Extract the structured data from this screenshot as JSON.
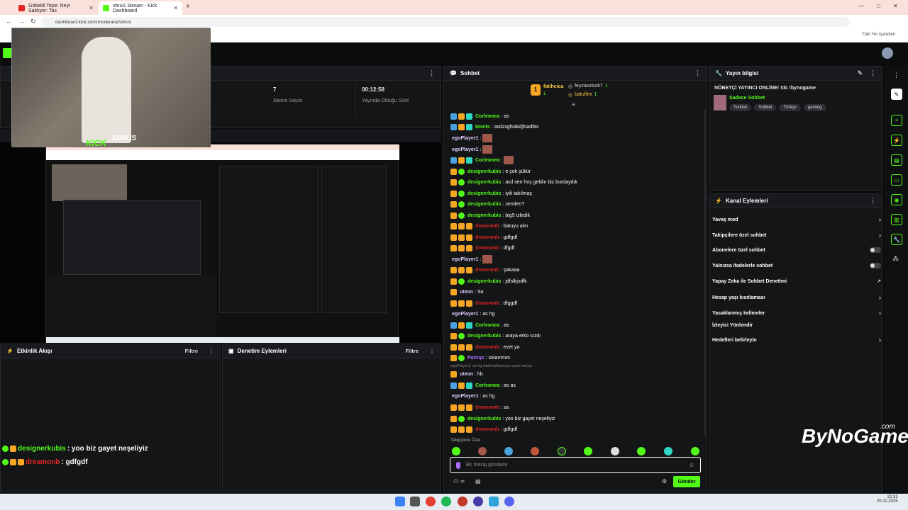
{
  "browser": {
    "tabs": [
      {
        "title": "Göbekli Tepe: Neyi Saklıyor: Tas"
      },
      {
        "title": "xbruS Stream - Kick Dashboard"
      }
    ],
    "new_tab": "+",
    "url": "dashboard.kick.com/moderator/xbrus",
    "bookmarks_label": "Tüm Yer İşaretleri",
    "window_controls": [
      "—",
      "□",
      "✕"
    ]
  },
  "stats": {
    "abone_value": "7",
    "abone_label": "Abone Sayısı",
    "time_value": "00:12:58",
    "time_label": "Yayında Olduğu Süre"
  },
  "webcam": {
    "brand": "KICK",
    "name": "XBRUS"
  },
  "activity": {
    "title": "Etkinlik Akışı",
    "filter": "Filtre"
  },
  "moderation": {
    "title": "Denetim Eylemleri",
    "filter": "Filtre"
  },
  "overlay_chat": [
    {
      "user": "designerkubis",
      "text": ": yoo biz gayet neşeliyiz"
    },
    {
      "user": "dreamonb",
      "text": ": gdfgdf"
    }
  ],
  "chat": {
    "title": "Sohbet",
    "top_gifter": {
      "name": "fatihcica",
      "count": "1"
    },
    "gifters": [
      {
        "name": "feyzaozturk7",
        "count": "1"
      },
      {
        "name": "batuflex",
        "count": "1"
      }
    ],
    "messages": [
      {
        "user": "Corleonea",
        "text": ": as",
        "color": "#53fc18"
      },
      {
        "user": "kmnts",
        "text": ": asdzxgfsakdjfsadfas",
        "color": "#53fc18"
      },
      {
        "user": "egoPlayer1",
        "text": ":",
        "color": "#e0c9ff"
      },
      {
        "user": "egoPlayer1",
        "text": ":",
        "color": "#e0c9ff"
      },
      {
        "user": "Corleonea",
        "text": ":",
        "color": "#53fc18"
      },
      {
        "user": "designerkubis",
        "text": ": e çok şükür",
        "color": "#53fc18"
      },
      {
        "user": "designerkubis",
        "text": ": asıl sen hoş geldin biz burdaydık",
        "color": "#53fc18"
      },
      {
        "user": "designerkubis",
        "text": ": iyili takılmaç",
        "color": "#53fc18"
      },
      {
        "user": "designerkubis",
        "text": ": senden?",
        "color": "#53fc18"
      },
      {
        "user": "designerkubis",
        "text": ": big5 izledik",
        "color": "#53fc18"
      },
      {
        "user": "dreamonb",
        "text": ": batuyu alın",
        "color": "#e02424"
      },
      {
        "user": "dreamonb",
        "text": ": gdfgdf",
        "color": "#e02424"
      },
      {
        "user": "dreamonb",
        "text": ": dfgdf",
        "color": "#e02424"
      },
      {
        "user": "egoPlayer1",
        "text": ":",
        "color": "#e0c9ff"
      },
      {
        "user": "dreamonb",
        "text": ": şakaaa",
        "color": "#e02424"
      },
      {
        "user": "designerkubis",
        "text": ": jdfslkjsdfk",
        "color": "#53fc18"
      },
      {
        "user": "uteon",
        "text": ": Sa",
        "color": "#e0c9ff"
      },
      {
        "user": "dreamonb",
        "text": ": dfggdf",
        "color": "#e02424"
      },
      {
        "user": "egoPlayer1",
        "text": ": as hg",
        "color": "#e0c9ff"
      },
      {
        "user": "Corleonea",
        "text": ": as",
        "color": "#53fc18"
      },
      {
        "user": "designerkubis",
        "text": ": araya erko sızdı",
        "color": "#53fc18"
      },
      {
        "user": "dreamonb",
        "text": ": evet ya",
        "color": "#e02424"
      },
      {
        "user": "Patriqs",
        "text": ": selammm",
        "color": "#a970ff"
      },
      {
        "user": "uteon",
        "text": ": hb",
        "color": "#e0c9ff"
      },
      {
        "user": "Corleonea",
        "text": ": as as",
        "color": "#53fc18"
      },
      {
        "user": "egoPlayer1",
        "text": ": as hg",
        "color": "#e0c9ff"
      },
      {
        "user": "dreamonb",
        "text": ": sa",
        "color": "#e02424"
      },
      {
        "user": "designerkubis",
        "text": ": yoo biz gayet neşeliyiz",
        "color": "#53fc18"
      },
      {
        "user": "dreamonb",
        "text": ": gdfgdf",
        "color": "#e02424"
      }
    ],
    "reply_note": "egoPlayer1: as hg isteli kullanıcıya yanıt veriyor",
    "followers_only": "Takipçilere Özel",
    "input_placeholder": "Bir mesaj gönderin",
    "send": "Gönder",
    "infinity": "∞"
  },
  "stream_info": {
    "title": "Yayın bilgisi",
    "stream_title": "NÖBETÇİ YAYINCI ONLİNE! !dc !bynogame",
    "category": "Sadece Sohbet",
    "tags": [
      "Turkish",
      "Sohbet",
      "Türkçe",
      "gaming"
    ]
  },
  "channel_actions": {
    "title": "Kanal Eylemleri",
    "items": [
      {
        "label": "Yavaş mod",
        "control": "arrow"
      },
      {
        "label": "Takipçilere özel sohbet",
        "control": "arrow"
      },
      {
        "label": "Abonelere özel sohbet",
        "control": "toggle"
      },
      {
        "label": "Yalnızca ifadelerle sohbet",
        "control": "toggle"
      },
      {
        "label": "Yapay Zeka ile Sohbet Denetimi",
        "control": "external"
      },
      {
        "label": "Hesap yaşı kısıtlaması",
        "control": "arrow"
      },
      {
        "label": "Yasaklanmış kelimeler",
        "control": "arrow"
      },
      {
        "label": "İzleyici Yönlendir",
        "control": "none"
      },
      {
        "label": "Hedefleri belirleyin",
        "control": "arrow"
      }
    ]
  },
  "watermark": {
    "text": "ByNoGame",
    "suffix": ".com"
  },
  "taskbar": {
    "time": "22:31",
    "date": "20.11.2025"
  },
  "colors": {
    "kick_green": "#53fc18",
    "panel_bg": "#141517",
    "page_bg": "#0b0c0d"
  }
}
